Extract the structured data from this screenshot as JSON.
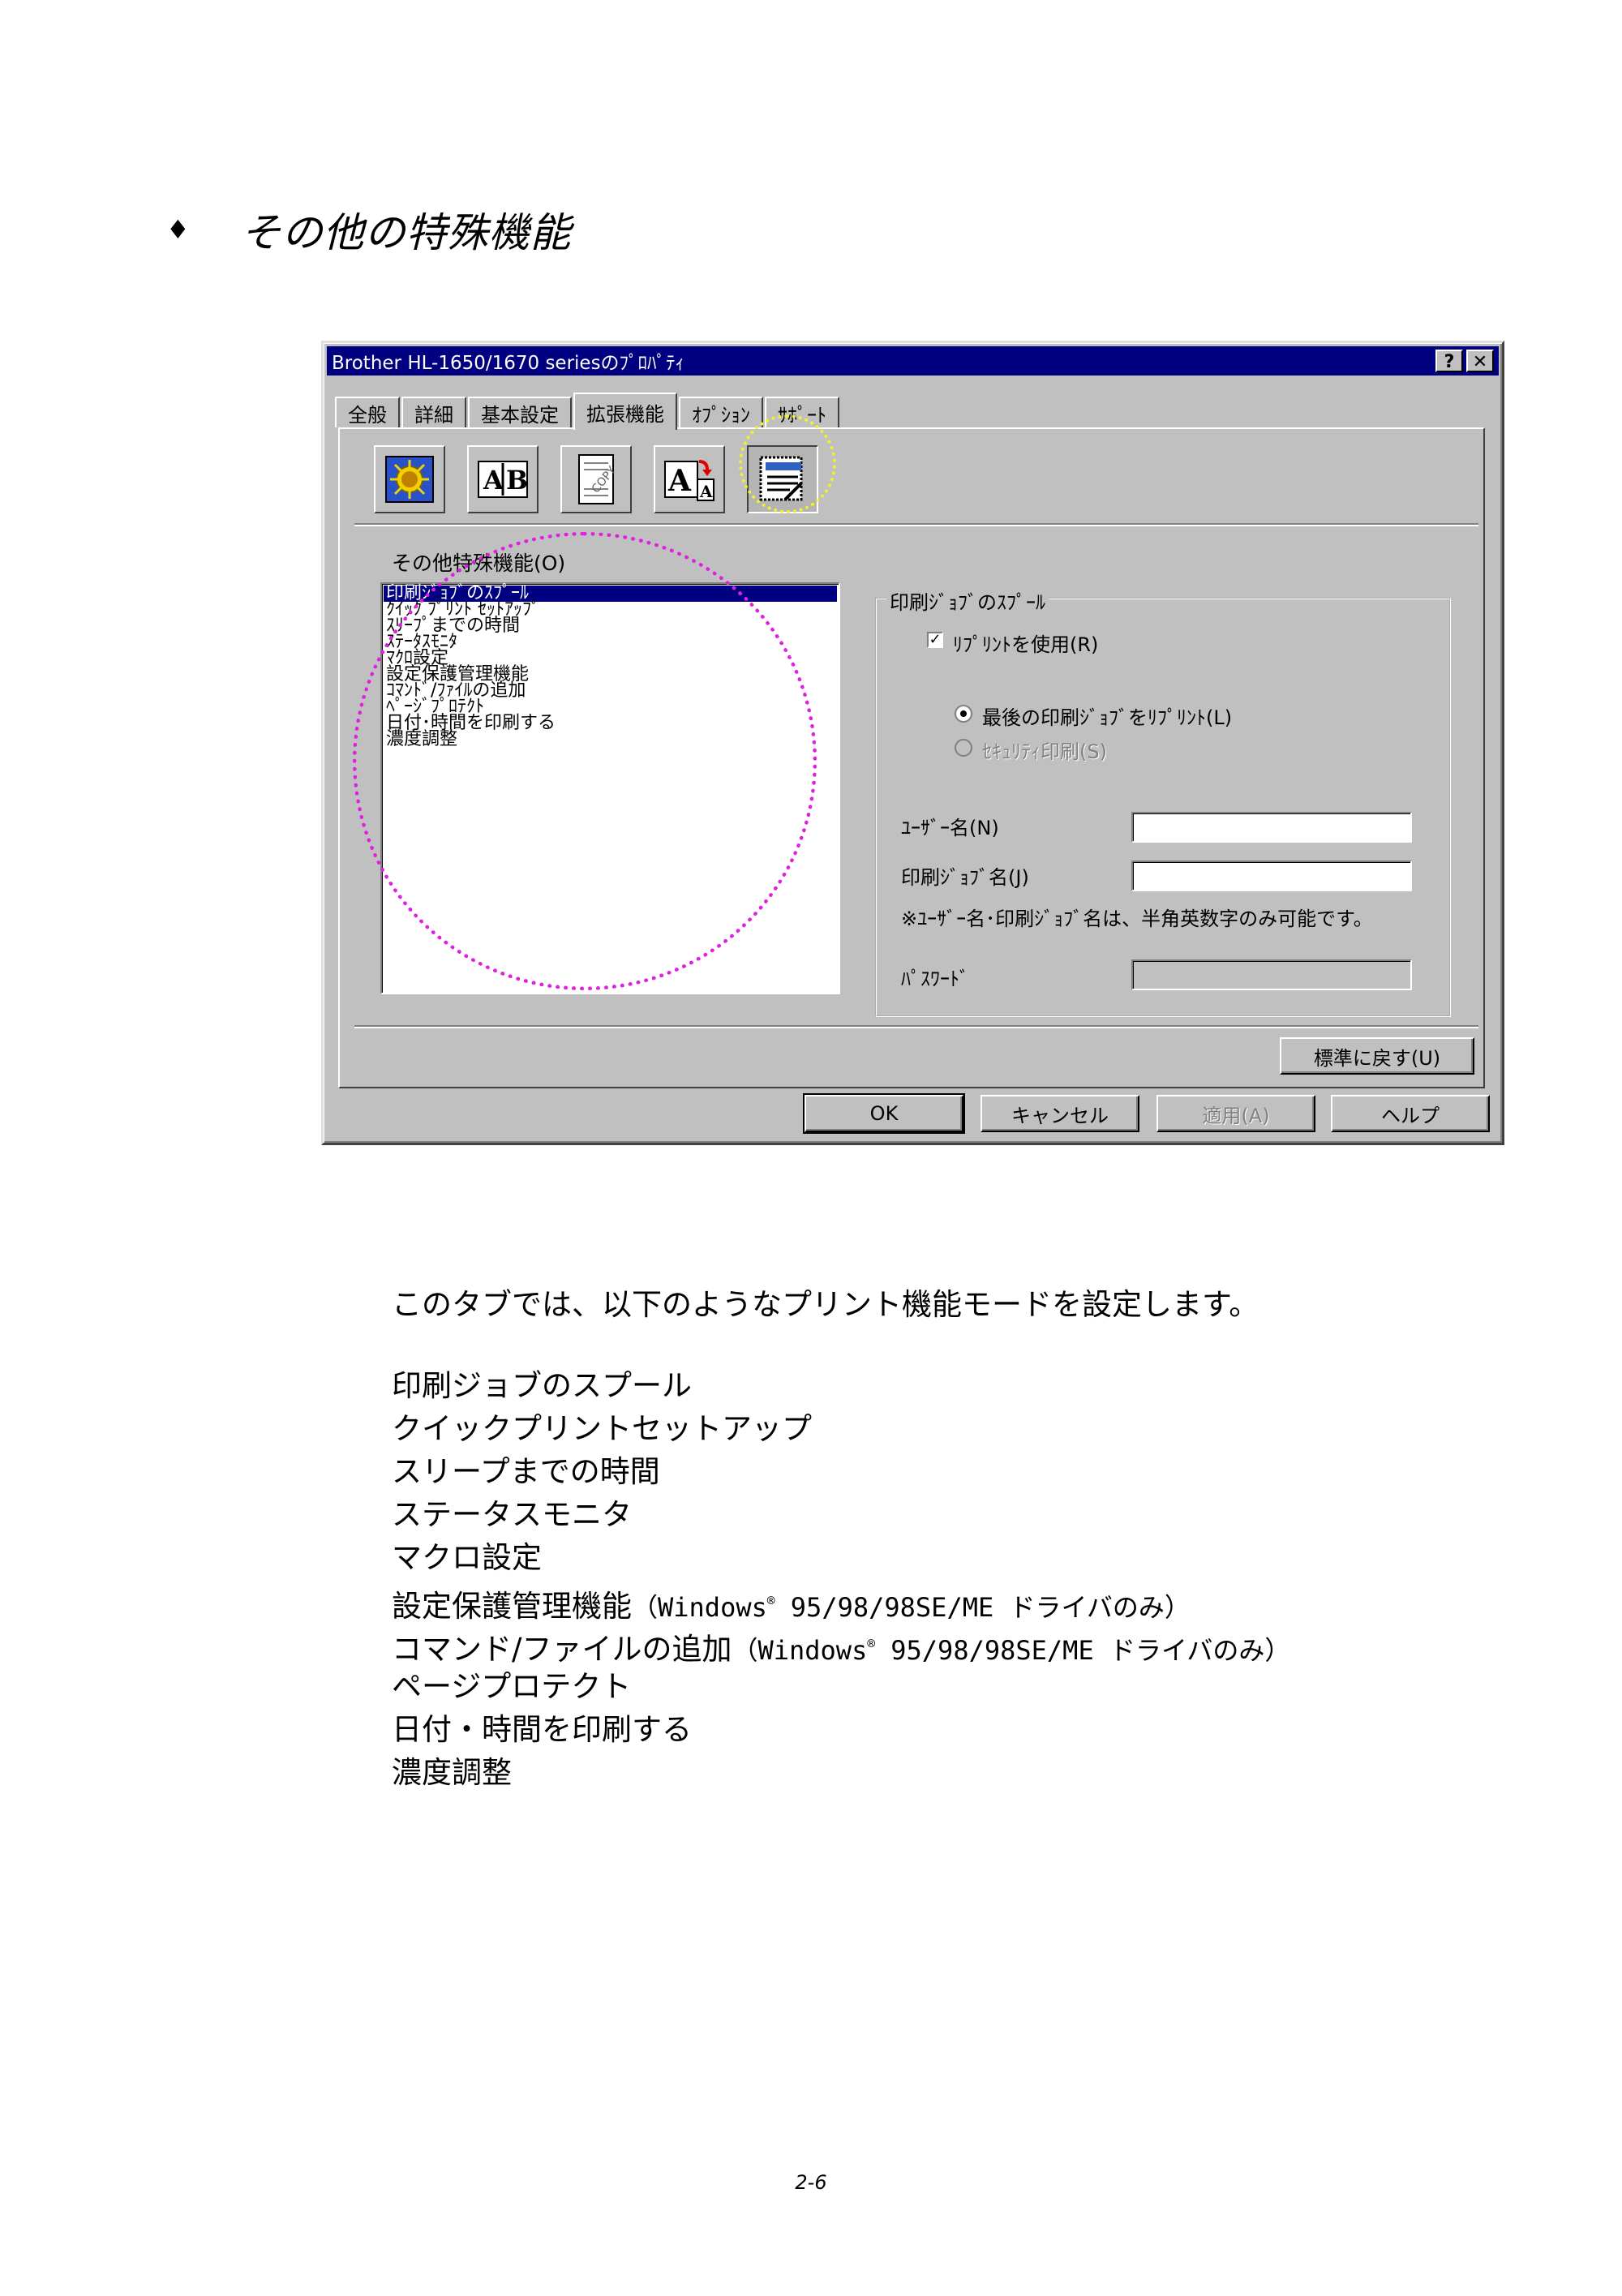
{
  "heading": {
    "bullet": "♦",
    "title": "その他の特殊機能"
  },
  "dialog": {
    "title": "Brother HL-1650/1670 seriesのﾌﾟﾛﾊﾟﾃｨ",
    "help_btn": "?",
    "close_btn": "✕",
    "tabs": [
      "全般",
      "詳細",
      "基本設定",
      "拡張機能",
      "ｵﾌﾟｼｮﾝ",
      "ｻﾎﾟｰﾄ"
    ],
    "active_tab": "拡張機能",
    "list_label": "その他特殊機能(O)",
    "list_items": [
      "印刷ｼﾞｮﾌﾞのｽﾌﾟｰﾙ",
      "ｸｲｯｸ ﾌﾟﾘﾝﾄ ｾｯﾄｱｯﾌﾟ",
      "ｽﾘｰﾌﾟまでの時間",
      "ｽﾃｰﾀｽﾓﾆﾀ",
      "ﾏｸﾛ設定",
      "設定保護管理機能",
      "ｺﾏﾝﾄﾞ/ﾌｧｲﾙの追加",
      "ﾍﾟｰｼﾞﾌﾟﾛﾃｸﾄ",
      "日付･時間を印刷する",
      "濃度調整"
    ],
    "group_title": "印刷ｼﾞｮﾌﾞのｽﾌﾟｰﾙ",
    "reprint_checkbox": "ﾘﾌﾟﾘﾝﾄを使用(R)",
    "radio_last_job": "最後の印刷ｼﾞｮﾌﾞをﾘﾌﾟﾘﾝﾄ(L)",
    "radio_security": "ｾｷｭﾘﾃｨ印刷(S)",
    "username_label": "ﾕｰｻﾞｰ名(N)",
    "jobname_label": "印刷ｼﾞｮﾌﾞ名(J)",
    "note": "※ﾕｰｻﾞｰ名･印刷ｼﾞｮﾌﾞ名は、半角英数字のみ可能です。",
    "password_label": "ﾊﾟｽﾜｰﾄﾞ",
    "default_btn": "標準に戻す(U)",
    "ok_btn": "OK",
    "cancel_btn": "キャンセル",
    "apply_btn": "適用(A)",
    "help_btn_label": "ヘルプ"
  },
  "body": {
    "intro": "このタブでは、以下のようなプリント機能モードを設定します。",
    "features": [
      "印刷ジョブのスプール",
      "クイックプリントセットアップ",
      "スリープまでの時間",
      "ステータスモニタ",
      "マクロ設定"
    ],
    "feature_settings": "設定保護管理機能",
    "feature_command": "コマンド/ファイルの追加",
    "note_prefix": "（Windows",
    "reg_mark": "®",
    "note_suffix": " 95/98/98SE/ME ドライバのみ）",
    "features_tail": [
      "ページプロテクト",
      "日付・時間を印刷する",
      "濃度調整"
    ]
  },
  "page_number": "2-6"
}
